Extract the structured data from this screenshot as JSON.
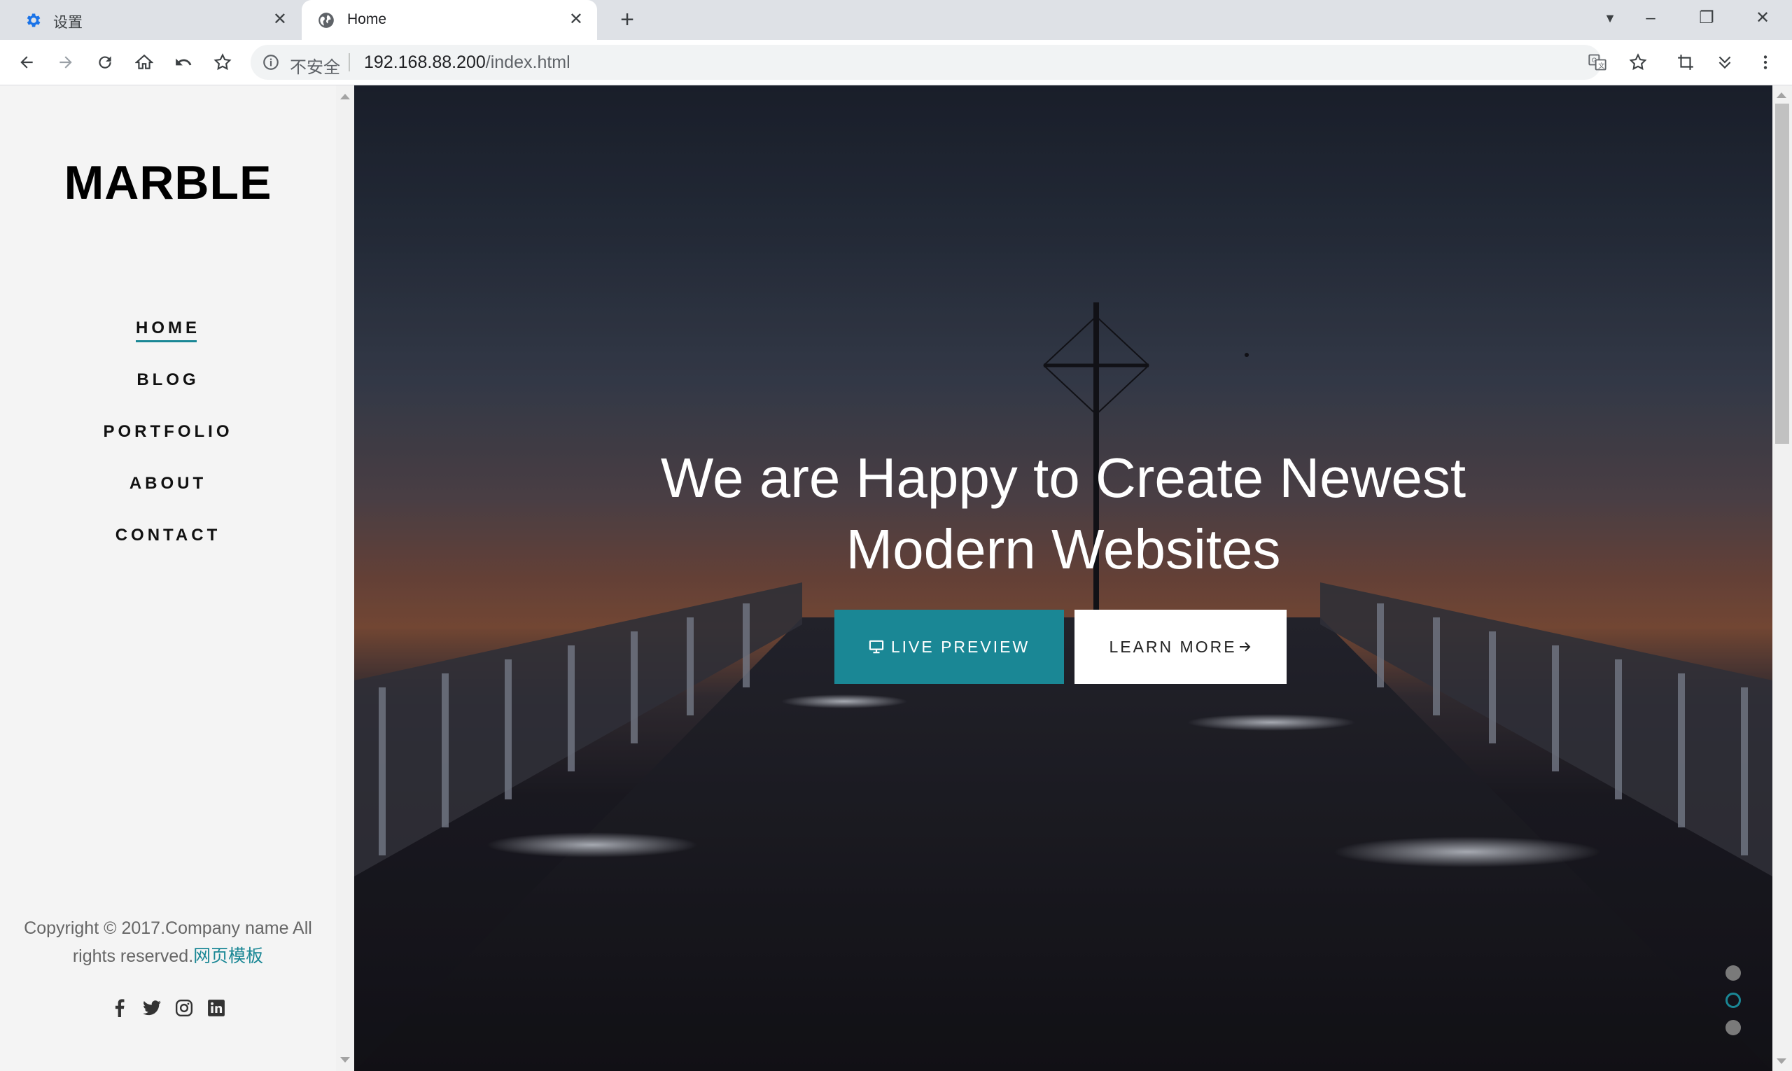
{
  "browser": {
    "tabs": [
      {
        "title": "设置",
        "icon": "gear-icon",
        "active": false
      },
      {
        "title": "Home",
        "icon": "globe-icon",
        "active": true
      }
    ],
    "new_tab_symbol": "+",
    "address": {
      "security_label": "不安全",
      "host": "192.168.88.200",
      "path": "/index.html"
    }
  },
  "sidebar": {
    "logo": "MARBLE",
    "nav": [
      {
        "label": "HOME",
        "active": true
      },
      {
        "label": "BLOG",
        "active": false
      },
      {
        "label": "PORTFOLIO",
        "active": false
      },
      {
        "label": "ABOUT",
        "active": false
      },
      {
        "label": "CONTACT",
        "active": false
      }
    ],
    "copyright": {
      "text": "Copyright © 2017.Company name All rights reserved.",
      "link": "网页模板"
    },
    "social": [
      "facebook-icon",
      "twitter-icon",
      "instagram-icon",
      "linkedin-icon"
    ]
  },
  "hero": {
    "title_line1": "We are Happy to Create Newest",
    "title_line2": "Modern Websites",
    "primary_button": "LIVE PREVIEW",
    "secondary_button": "LEARN MORE",
    "slide_count": 3,
    "active_slide": 2
  },
  "colors": {
    "accent": "#1a8795",
    "chrome_tabbar": "#dee1e6",
    "sidebar_bg": "#f4f4f4"
  }
}
